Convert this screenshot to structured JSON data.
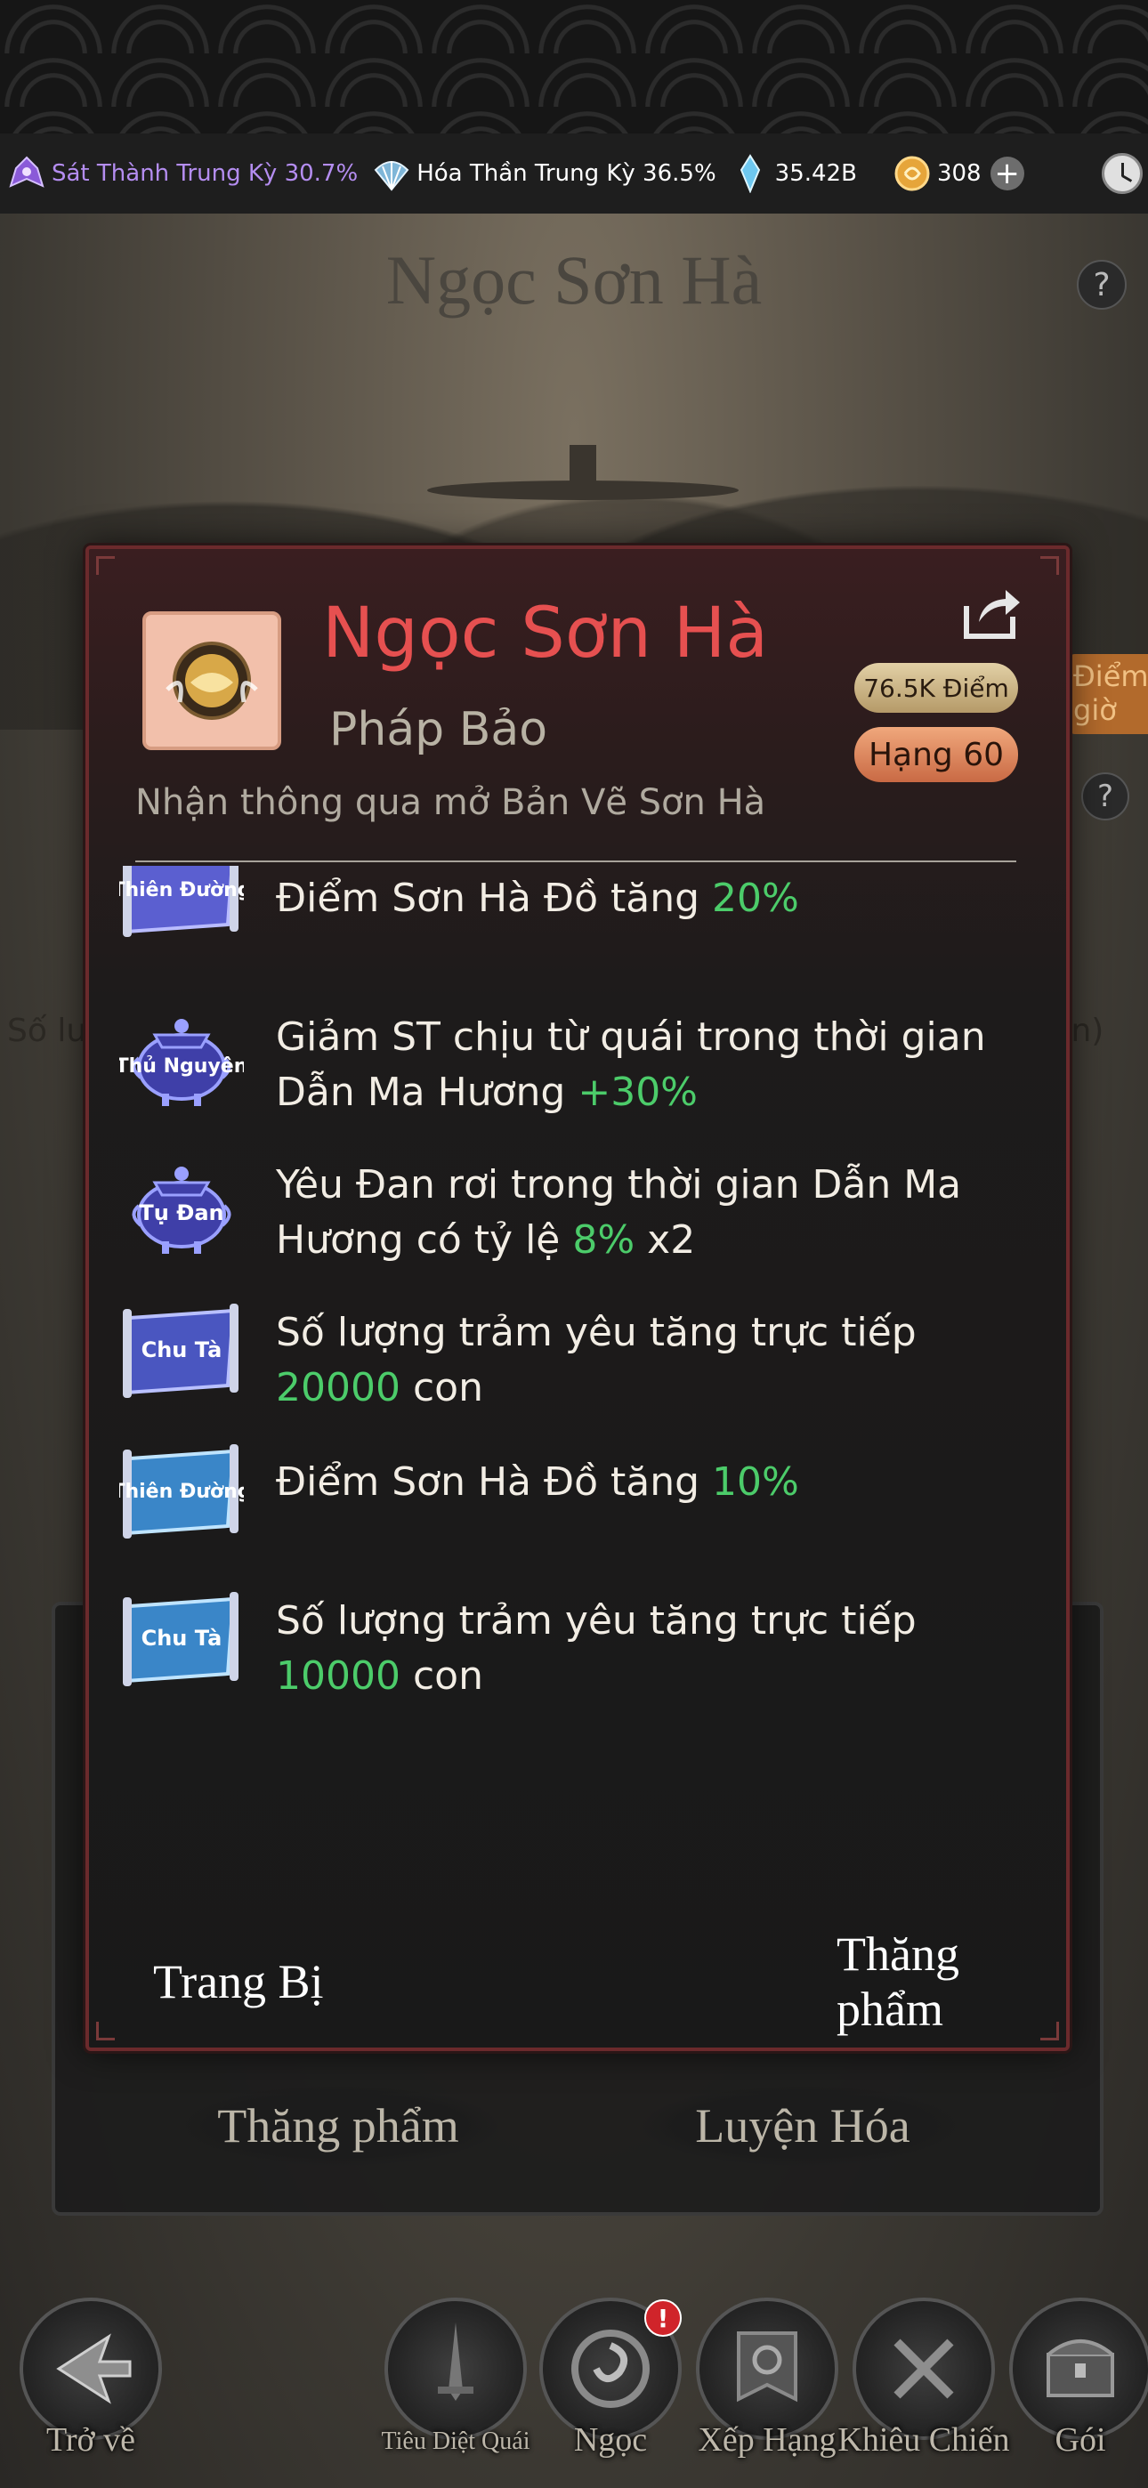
{
  "resources": {
    "realm1": "Sát Thành Trung Kỳ 30.7%",
    "realm2": "Hóa Thần Trung Kỳ 36.5%",
    "gems": "35.42B",
    "gold": "308"
  },
  "page_title": "Ngọc Sơn Hà",
  "background": {
    "left_text": "Số lu",
    "right_text": "yên)",
    "right_badge_line1": "Điểm",
    "right_badge_line2": "giờ"
  },
  "modal": {
    "item_name": "Ngọc Sơn Hà",
    "item_type": "Pháp Bảo",
    "points": "76.5K Điểm",
    "rank": "Hạng 60",
    "source": "Nhận thông qua mở Bản Vẽ Sơn Hà",
    "effects": [
      {
        "badge": "Thiên Đường",
        "text": "Điểm Sơn Hà Đồ tăng ",
        "highlight": "20%",
        "suffix": ""
      },
      {
        "badge": "Thủ Nguyên",
        "text": "Giảm ST chịu từ quái trong thời gian Dẫn Ma Hương ",
        "highlight": "+30%",
        "suffix": ""
      },
      {
        "badge": "Tụ Đan",
        "text": "Yêu Đan rơi trong thời gian Dẫn Ma Hương có tỷ lệ ",
        "highlight": "8%",
        "suffix": " x2"
      },
      {
        "badge": "Chu Tà",
        "text": "Số lượng trảm yêu tăng trực tiếp ",
        "highlight": "20000",
        "suffix": " con"
      },
      {
        "badge": "Thiên Đường",
        "text": "Điểm Sơn Hà Đồ tăng ",
        "highlight": "10%",
        "suffix": ""
      },
      {
        "badge": "Chu Tà",
        "text": "Số lượng trảm yêu tăng trực tiếp ",
        "highlight": "10000",
        "suffix": " con"
      }
    ],
    "equip_label": "Trang Bị",
    "upgrade_label": "Thăng phẩm"
  },
  "back_panel": {
    "upgrade_label": "Thăng phẩm",
    "refine_label": "Luyện Hóa"
  },
  "nav": {
    "back": "Trở về",
    "kill_monster": "Tiêu Diệt Quái",
    "jade": "Ngọc",
    "ranking": "Xếp Hạng",
    "challenge": "Khiêu Chiến",
    "pack": "Gói",
    "jade_badge": "!"
  },
  "colors": {
    "highlight_green": "#4ccc6a",
    "item_name_red": "#e65050",
    "realm1_purple": "#b48df0"
  }
}
